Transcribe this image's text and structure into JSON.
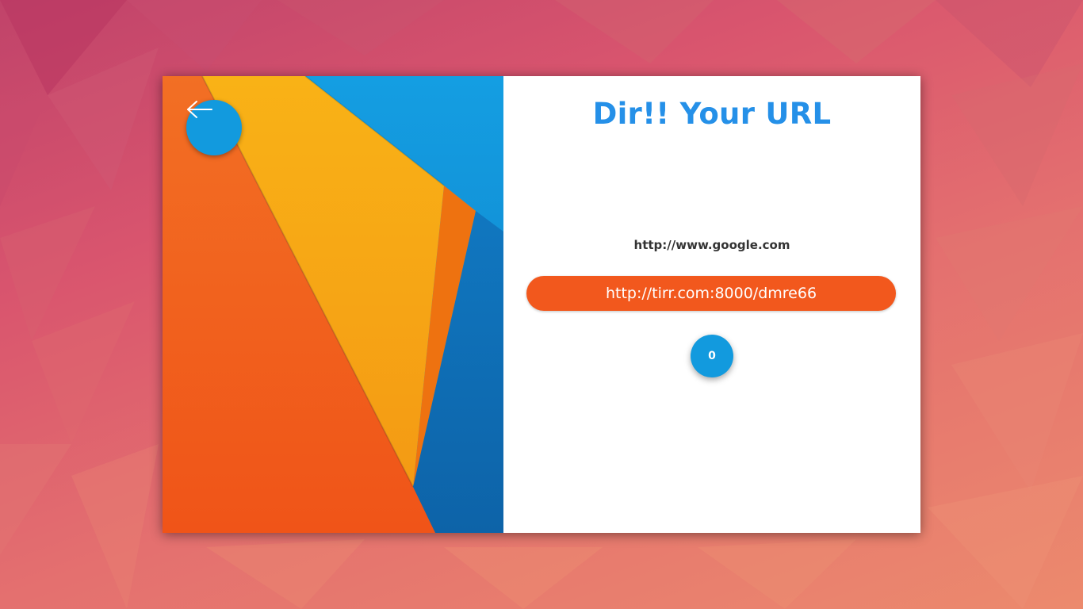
{
  "title": "Dir!! Your URL",
  "original_url": "http://www.google.com",
  "short_url": "http://tirr.com:8000/dmre66",
  "click_count": "0",
  "back_button": {
    "icon": "arrow-left-icon"
  },
  "colors": {
    "title": "#2590e8",
    "accent_blue": "#129ade",
    "accent_orange": "#f2581d",
    "yellow": "#f7a81a"
  }
}
